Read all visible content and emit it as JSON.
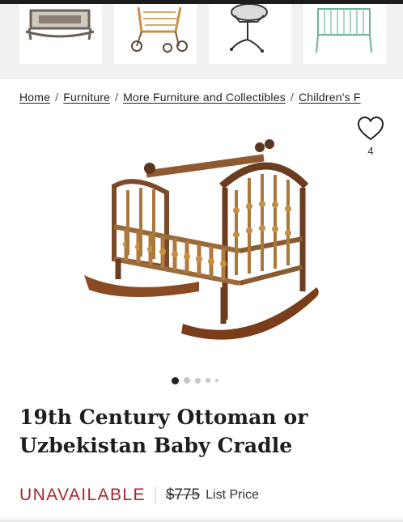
{
  "related_items": [
    {
      "icon": "cradle-thumbnail"
    },
    {
      "icon": "stroller-thumbnail"
    },
    {
      "icon": "bassinet-thumbnail"
    },
    {
      "icon": "crib-thumbnail"
    }
  ],
  "breadcrumb": {
    "items": [
      "Home",
      "Furniture",
      "More Furniture and Collectibles",
      "Children's F"
    ],
    "separator": "/"
  },
  "favorite": {
    "icon": "heart-icon",
    "count": "4"
  },
  "carousel": {
    "total_dots": 5,
    "active_index": 0
  },
  "product": {
    "title": "19th Century Ottoman or Uzbekistan Baby Cradle",
    "status": "UNAVAILABLE",
    "price": "$775",
    "price_label": "List Price"
  },
  "colors": {
    "status": "#a5262f",
    "text": "#222222",
    "strip_bg": "#f1f1f1"
  }
}
